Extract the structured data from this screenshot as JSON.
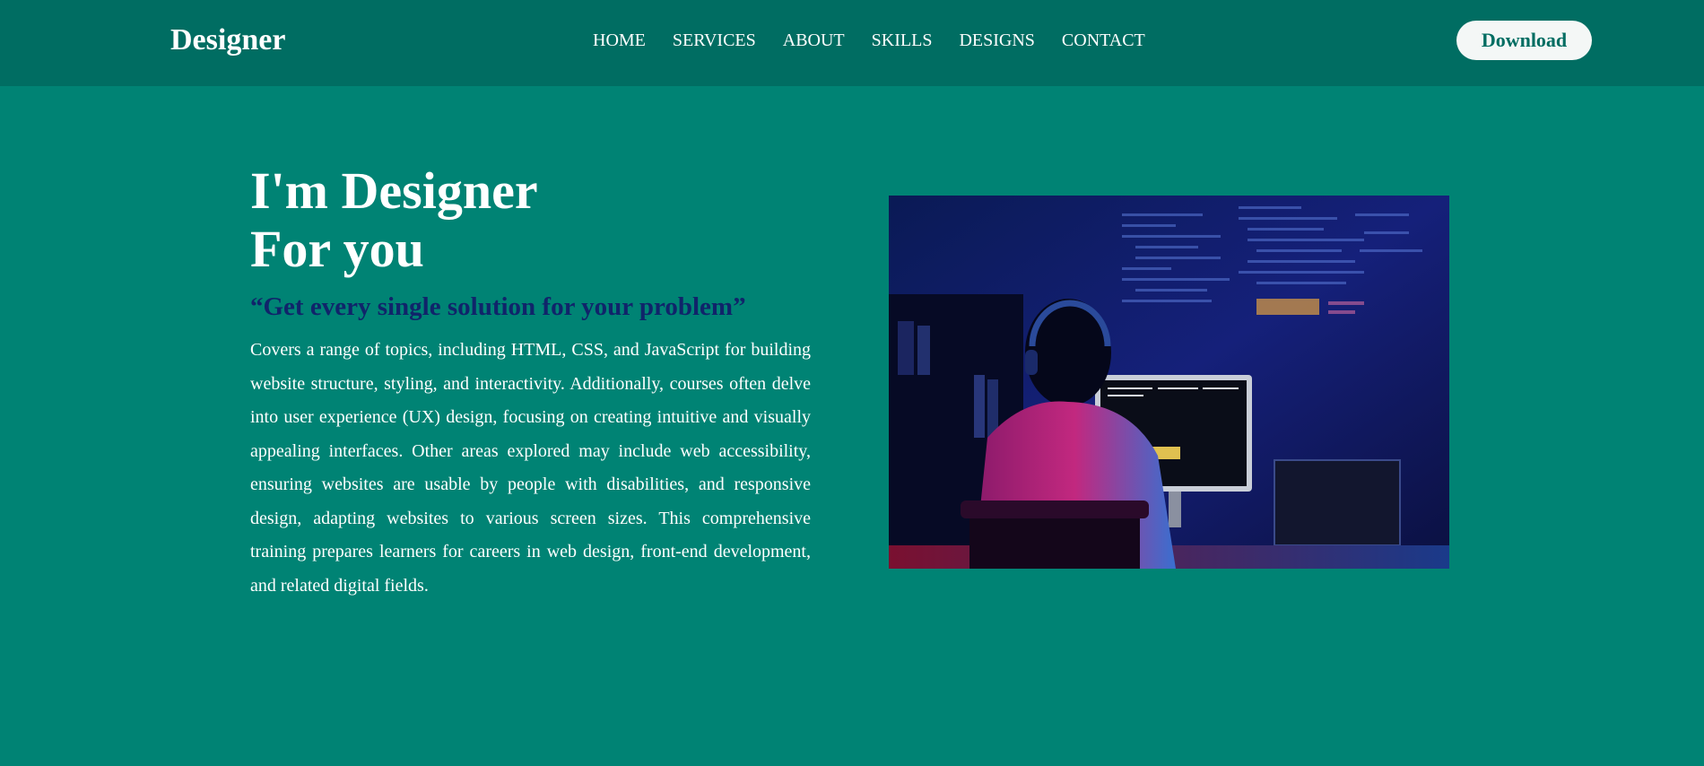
{
  "header": {
    "logo": "Designer",
    "nav": [
      "HOME",
      "SERVICES",
      "ABOUT",
      "SKILLS",
      "DESIGNS",
      "CONTACT"
    ],
    "download_label": "Download"
  },
  "hero": {
    "title_line1": "I'm Designer",
    "title_line2": "For you",
    "quote": "“Get every single solution for your problem”",
    "description": "Covers a range of topics, including HTML, CSS, and JavaScript for building website structure, styling, and interactivity. Additionally, courses often delve into user experience (UX) design, focusing on creating intuitive and visually appealing interfaces. Other areas explored may include web accessibility, ensuring websites are usable by people with disabilities, and responsive design, adapting websites to various screen sizes. This comprehensive training prepares learners for careers in web design, front-end development, and related digital fields."
  },
  "colors": {
    "background": "#008374",
    "header": "#006d62",
    "quote": "#10246a",
    "button_bg": "#f4f7f6",
    "button_text": "#006d62"
  }
}
